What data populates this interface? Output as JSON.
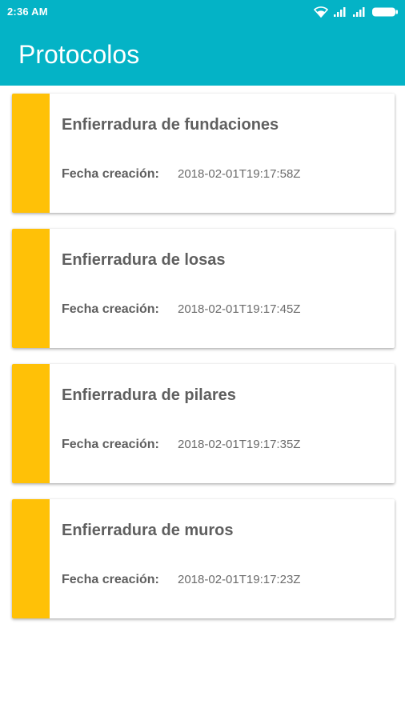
{
  "status_bar": {
    "time": "2:36 AM",
    "icons": [
      "wifi-icon",
      "signal-icon",
      "signal-icon",
      "battery-icon"
    ]
  },
  "app_bar": {
    "title": "Protocolos",
    "color": "#04b3c6"
  },
  "colors": {
    "accent_stripe": "#ffc107",
    "text": "#5f5f5f"
  },
  "protocols": [
    {
      "title": "Enfierradura de fundaciones",
      "date_label": "Fecha creación:",
      "date": "2018-02-01T19:17:58Z"
    },
    {
      "title": "Enfierradura de losas",
      "date_label": "Fecha creación:",
      "date": "2018-02-01T19:17:45Z"
    },
    {
      "title": "Enfierradura de pilares",
      "date_label": "Fecha creación:",
      "date": "2018-02-01T19:17:35Z"
    },
    {
      "title": "Enfierradura de muros",
      "date_label": "Fecha creación:",
      "date": "2018-02-01T19:17:23Z"
    }
  ]
}
